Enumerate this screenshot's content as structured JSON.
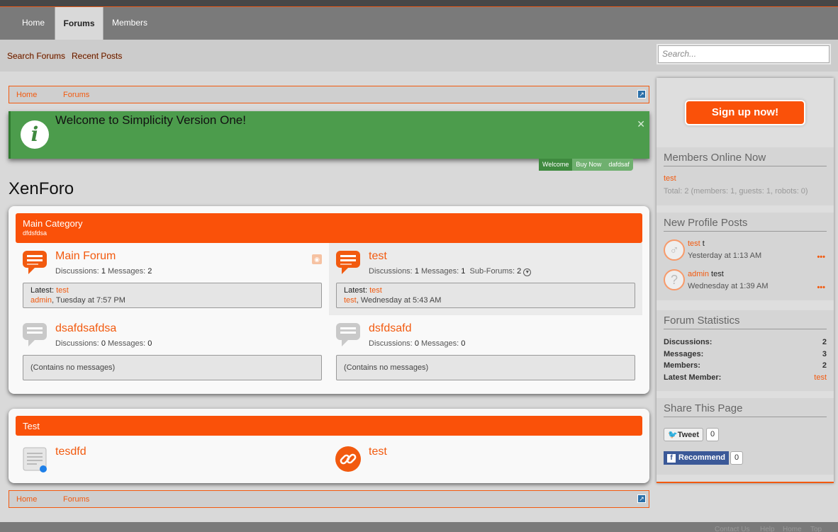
{
  "nav": {
    "tabs": [
      "Home",
      "Forums",
      "Members"
    ],
    "active": "Forums"
  },
  "subnav": {
    "links": [
      "Search Forums",
      "Recent Posts"
    ]
  },
  "search": {
    "placeholder": "Search..."
  },
  "breadcrumb": {
    "items": [
      "Home",
      "Forums"
    ]
  },
  "notice": {
    "message": "Welcome to Simplicity Version One!",
    "tabs": [
      "Welcome",
      "Buy Now",
      "dafdsaf"
    ]
  },
  "page_title": "XenForo",
  "categories": [
    {
      "title": "Main Category",
      "description": "dfdsfdsa",
      "nodes": [
        {
          "name": "Main Forum",
          "discussions_label": "Discussions:",
          "discussions": "1",
          "messages_label": "Messages:",
          "messages": "2",
          "latest_label": "Latest:",
          "latest_thread": "test",
          "latest_user": "admin",
          "latest_date": ", Tuesday at 7:57 PM"
        },
        {
          "name": "test",
          "discussions_label": "Discussions:",
          "discussions": "1",
          "messages_label": "Messages:",
          "messages": "1",
          "subforums_label": "Sub-Forums:",
          "subforums": "2",
          "latest_label": "Latest:",
          "latest_thread": "test",
          "latest_user": "test",
          "latest_date": ", Wednesday at 5:43 AM"
        },
        {
          "name": "dsafdsafdsa",
          "discussions_label": "Discussions:",
          "discussions": "0",
          "messages_label": "Messages:",
          "messages": "0",
          "empty": "(Contains no messages)"
        },
        {
          "name": "dsfdsafd",
          "discussions_label": "Discussions:",
          "discussions": "0",
          "messages_label": "Messages:",
          "messages": "0",
          "empty": "(Contains no messages)"
        }
      ]
    },
    {
      "title": "Test",
      "nodes": [
        {
          "name": "tesdfd"
        },
        {
          "name": "test"
        }
      ]
    }
  ],
  "sidebar": {
    "signup": "Sign up now!",
    "members_online": {
      "title": "Members Online Now",
      "users": [
        "test"
      ],
      "total": "Total: 2 (members: 1, guests: 1, robots: 0)"
    },
    "profile_posts": {
      "title": "New Profile Posts",
      "posts": [
        {
          "user": "test",
          "text": "t",
          "time": "Yesterday at 1:13 AM"
        },
        {
          "user": "admin",
          "text": "test",
          "time": "Wednesday at 1:39 AM"
        }
      ],
      "more": "•••"
    },
    "stats": {
      "title": "Forum Statistics",
      "rows": [
        {
          "label": "Discussions:",
          "value": "2"
        },
        {
          "label": "Messages:",
          "value": "3"
        },
        {
          "label": "Members:",
          "value": "2"
        },
        {
          "label": "Latest Member:",
          "value": "test"
        }
      ]
    },
    "share": {
      "title": "Share This Page",
      "tweet": "Tweet",
      "tweet_count": "0",
      "recommend": "Recommend",
      "recommend_count": "0"
    }
  },
  "footer": {
    "links": [
      "Contact Us",
      "Help",
      "Home",
      "Top"
    ]
  },
  "colors": {
    "accent": "#fa5109",
    "notice_green": "#4c9c4c",
    "nav_gray": "#7a7a7a"
  }
}
